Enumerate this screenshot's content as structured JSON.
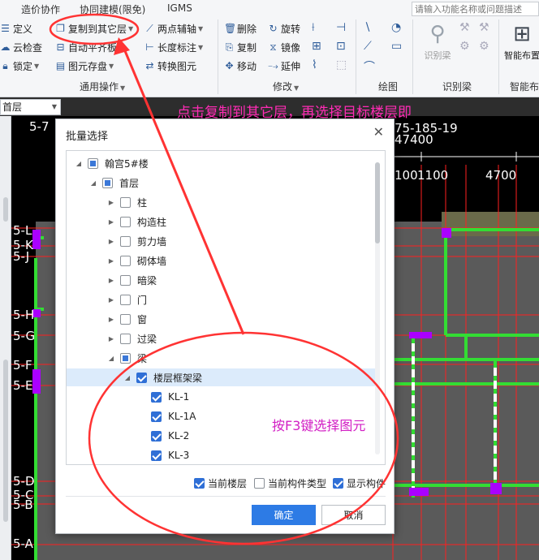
{
  "menu": {
    "tabs": [
      "造价协作",
      "协同建模(限免)",
      "IGMS"
    ],
    "search_placeholder": "请输入功能名称或问题描述"
  },
  "ribbon": {
    "general": {
      "items": [
        "定义",
        "云检查",
        "锁定",
        "复制到其它层",
        "自动平齐板",
        "图元存盘",
        "两点辅轴",
        "长度标注",
        "转换图元"
      ],
      "label": "通用操作"
    },
    "modify": {
      "items": [
        "删除",
        "旋转",
        "复制",
        "镜像",
        "移动",
        "延伸"
      ],
      "label": "修改"
    },
    "draw": {
      "label": "绘图"
    },
    "identify_beam": {
      "button": "识别梁",
      "label": "识别梁"
    },
    "smart_layout": {
      "button": "智能布置",
      "label": "智能布"
    }
  },
  "layer_select": {
    "value": "首层"
  },
  "canvas": {
    "axis_labels": [
      "5-7",
      "5-L",
      "5-K",
      "5-J",
      "5-H",
      "5-G",
      "5-F",
      "5-E",
      "5-D",
      "5-C",
      "5-B",
      "5-A"
    ],
    "dims": [
      "75-185-19",
      "47400",
      "100",
      "1100",
      "4700"
    ]
  },
  "annotations": {
    "top_note": "点击复制到其它层，再选择目标楼层即",
    "f3_note": "按F3键选择图元"
  },
  "dialog": {
    "title": "批量选择",
    "tree": [
      {
        "label": "翰宫5#楼",
        "state": "partial"
      },
      {
        "label": "首层",
        "state": "partial"
      },
      {
        "label": "柱",
        "state": "unchecked"
      },
      {
        "label": "构造柱",
        "state": "unchecked"
      },
      {
        "label": "剪力墙",
        "state": "unchecked"
      },
      {
        "label": "砌体墙",
        "state": "unchecked"
      },
      {
        "label": "暗梁",
        "state": "unchecked"
      },
      {
        "label": "门",
        "state": "unchecked"
      },
      {
        "label": "窗",
        "state": "unchecked"
      },
      {
        "label": "过梁",
        "state": "unchecked"
      },
      {
        "label": "梁",
        "state": "partial"
      },
      {
        "label": "楼层框架梁",
        "state": "checked"
      },
      {
        "label": "KL-1",
        "state": "checked"
      },
      {
        "label": "KL-1A",
        "state": "checked"
      },
      {
        "label": "KL-2",
        "state": "checked"
      },
      {
        "label": "KL-3",
        "state": "checked"
      }
    ],
    "options": [
      {
        "label": "当前楼层",
        "checked": true
      },
      {
        "label": "当前构件类型",
        "checked": false
      },
      {
        "label": "显示构件",
        "checked": true
      }
    ],
    "ok": "确定",
    "cancel": "取消"
  },
  "colors": {
    "accent": "#2d7be5",
    "annotation": "#ff2bb5",
    "beam": "#33dd33",
    "axis": "#ff2020",
    "column": "#aa00ff"
  }
}
